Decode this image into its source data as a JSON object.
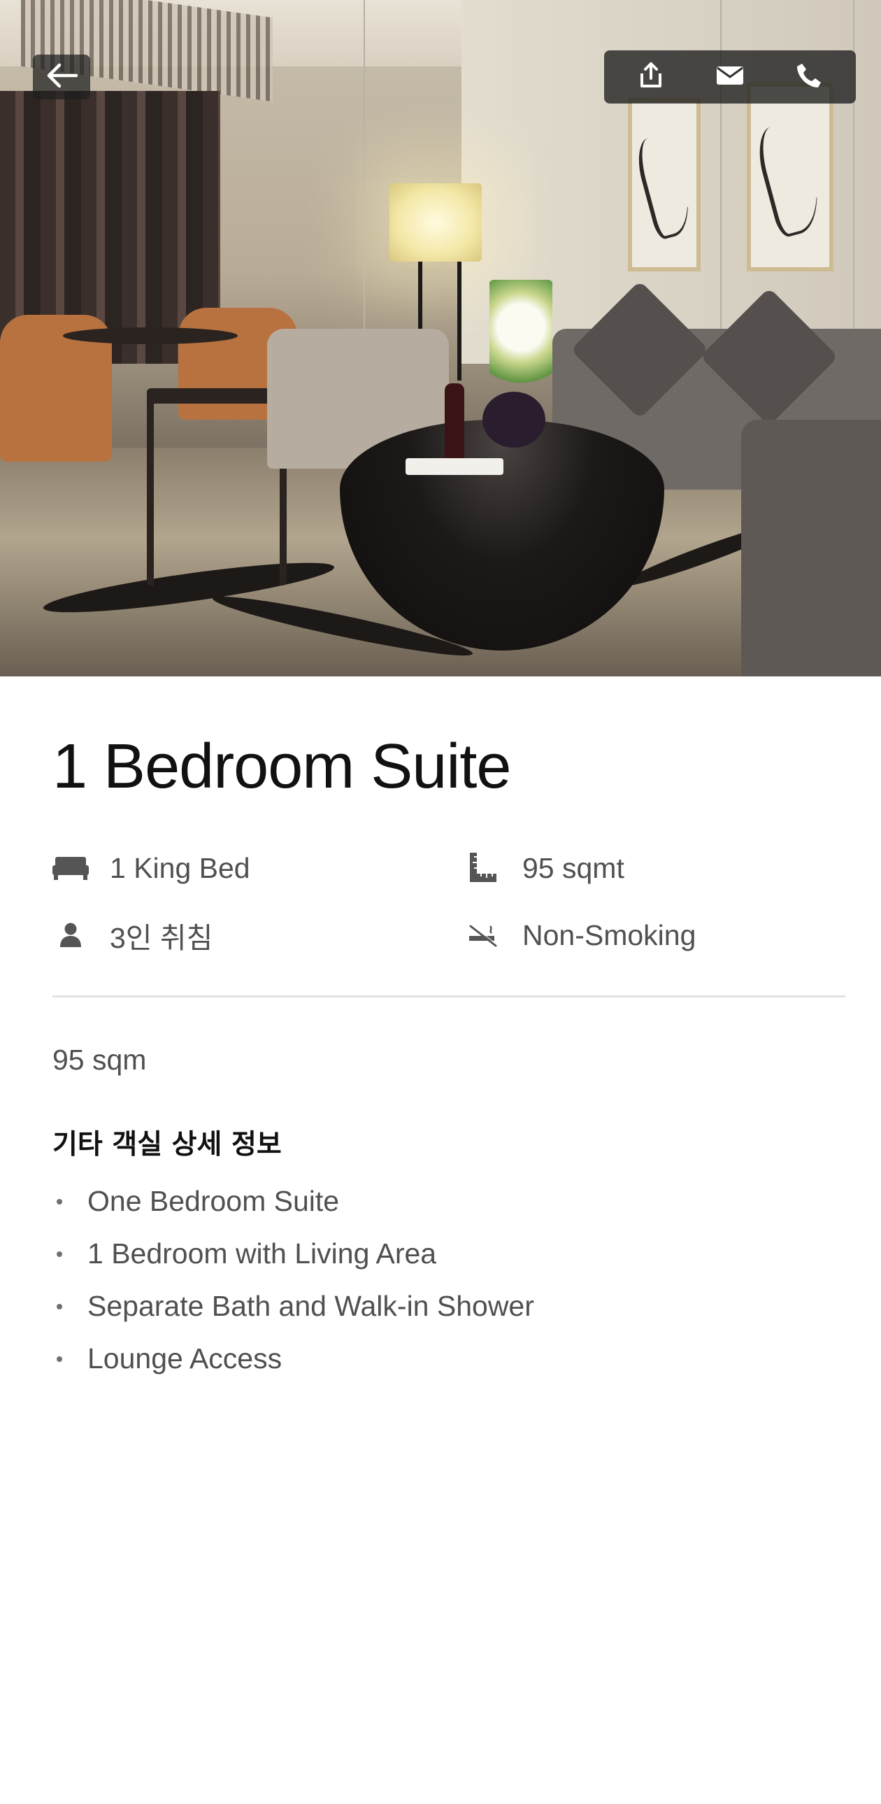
{
  "photo": {
    "subject": "hotel suite living room"
  },
  "nav": {
    "back_icon": "arrow-left-icon",
    "actions": [
      {
        "icon": "share-icon",
        "label": "share"
      },
      {
        "icon": "mail-icon",
        "label": "mail"
      },
      {
        "icon": "phone-icon",
        "label": "phone"
      }
    ]
  },
  "room": {
    "title": "1 Bedroom Suite",
    "features": {
      "bed": {
        "icon": "bed-icon",
        "text": "1 King Bed"
      },
      "area": {
        "icon": "ruler-icon",
        "text": "95 sqmt"
      },
      "occupancy": {
        "icon": "person-icon",
        "text": "3인 취침"
      },
      "smoking": {
        "icon": "no-smoking-icon",
        "text": "Non-Smoking"
      }
    },
    "size": "95 sqm",
    "details_heading": "기타 객실 상세 정보",
    "details": [
      "One Bedroom Suite",
      "1 Bedroom with Living Area",
      "Separate Bath and Walk-in Shower",
      "Lounge Access"
    ]
  },
  "colors": {
    "text_primary": "#111111",
    "text_secondary": "#505050",
    "icon": "#555555",
    "overlay": "#1e1e1e",
    "divider": "#e1e1e1"
  }
}
